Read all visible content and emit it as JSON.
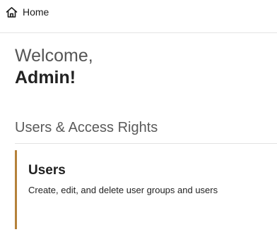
{
  "nav": {
    "home_label": "Home",
    "home_icon": "home-icon"
  },
  "welcome": {
    "greeting": "Welcome,",
    "name": "Admin!"
  },
  "section": {
    "title": "Users & Access Rights"
  },
  "cards": [
    {
      "title": "Users",
      "description": "Create, edit, and delete user groups and users",
      "accent_color": "#b5813a"
    }
  ]
}
